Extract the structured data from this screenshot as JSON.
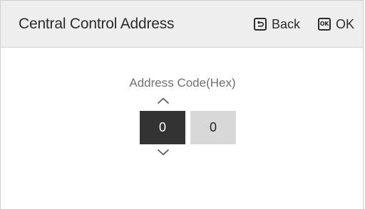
{
  "header": {
    "title": "Central Control Address",
    "back_label": "Back",
    "ok_label": "OK",
    "ok_icon_text": "OK"
  },
  "main": {
    "label": "Address Code(Hex)",
    "digits": [
      "0",
      "0"
    ],
    "selected_digit_index": 0
  },
  "colors": {
    "header_bg": "#eeeeee",
    "selected_digit_bg": "#333333",
    "unselected_digit_bg": "#d8d8d8"
  },
  "icons": {
    "back": "return-icon",
    "ok": "ok-icon",
    "up": "chevron-up-icon",
    "down": "chevron-down-icon"
  }
}
